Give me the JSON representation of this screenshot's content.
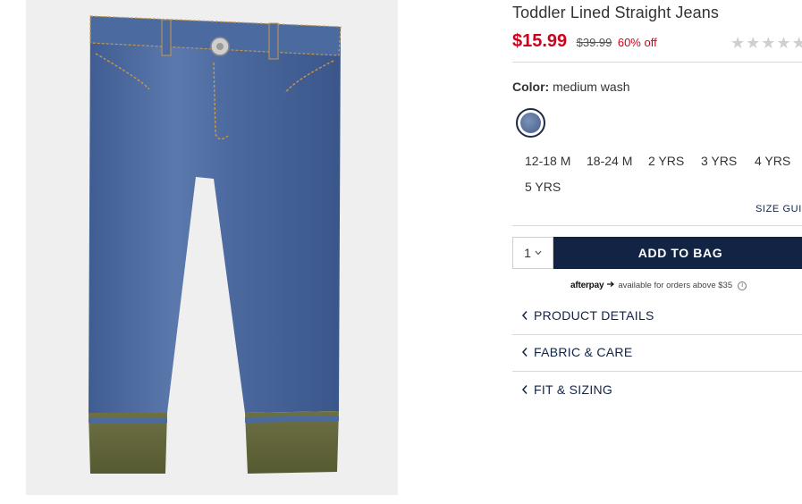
{
  "product": {
    "title": "Toddler Lined Straight Jeans",
    "sale_price": "$15.99",
    "original_price": "$39.99",
    "discount": "60% off",
    "rating_stars": "★★★★★",
    "rating_value": 0
  },
  "color": {
    "label": "Color:",
    "value": "medium wash",
    "swatch_color": "#5d75a0"
  },
  "sizes": [
    "12-18 M",
    "18-24 M",
    "2 YRS",
    "3 YRS",
    "4 YRS",
    "5 YRS"
  ],
  "size_guide": "SIZE GUID",
  "bag": {
    "quantity": "1",
    "add_label": "ADD TO BAG"
  },
  "afterpay": {
    "logo": "afterpay",
    "text": "available for orders above $35",
    "info": "i"
  },
  "accordions": [
    "PRODUCT DETAILS",
    "FABRIC & CARE",
    "FIT & SIZING"
  ],
  "colors": {
    "brand_navy": "#122344",
    "sale_red": "#d0021b"
  }
}
